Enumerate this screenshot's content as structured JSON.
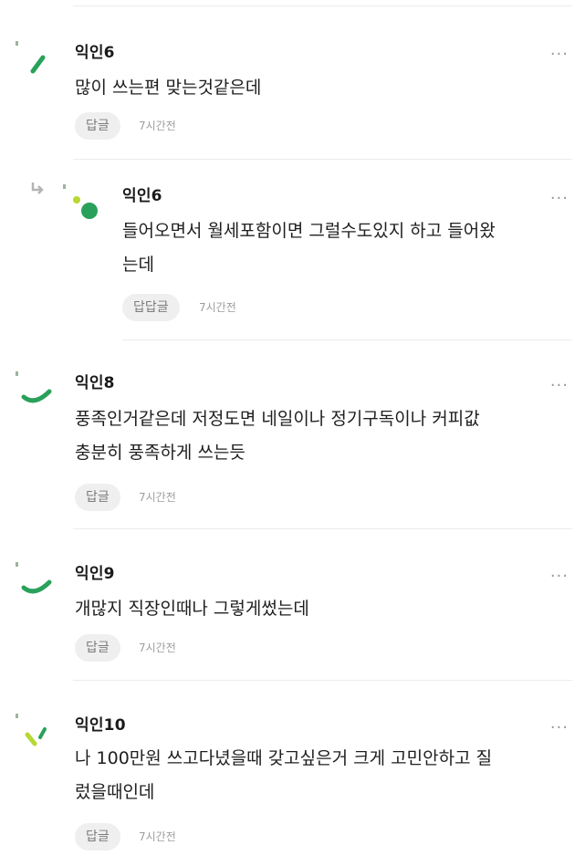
{
  "comments": [
    {
      "author": "익인6",
      "lines": [
        "많이 쓰는편 맞는것같은데"
      ],
      "reply_label": "답글",
      "time": "7시간전",
      "avatar_icon": "stroke-avatar-icon",
      "is_reply": false
    },
    {
      "author": "익인6",
      "lines": [
        "들어오면서 월세포함이면 그럴수도있지 하고 들어왔",
        "는데"
      ],
      "reply_label": "답답글",
      "time": "7시간전",
      "avatar_icon": "dot-avatar-icon",
      "is_reply": true
    },
    {
      "author": "익인8",
      "lines": [
        "풍족인거같은데 저정도면 네일이나 정기구독이나 커피값",
        "충분히 풍족하게 쓰는듯"
      ],
      "reply_label": "답글",
      "time": "7시간전",
      "avatar_icon": "curve-avatar-icon",
      "is_reply": false
    },
    {
      "author": "익인9",
      "lines": [
        "개많지 직장인때나 그렇게썼는데"
      ],
      "reply_label": "답글",
      "time": "7시간전",
      "avatar_icon": "curve-avatar-icon",
      "is_reply": false
    },
    {
      "author": "익인10",
      "lines": [
        "나 100만원 쓰고다녔을때 갖고싶은거 크게 고민안하고 질",
        "렀을때인데"
      ],
      "reply_label": "답글",
      "time": "7시간전",
      "avatar_icon": "tick-avatar-icon",
      "is_reply": false
    }
  ],
  "more_label": "···",
  "colors": {
    "avatar_green": "#2aa15a",
    "avatar_lime": "#b7d733",
    "reply_bg": "#efefef",
    "meta_text": "#9d9d9d"
  }
}
